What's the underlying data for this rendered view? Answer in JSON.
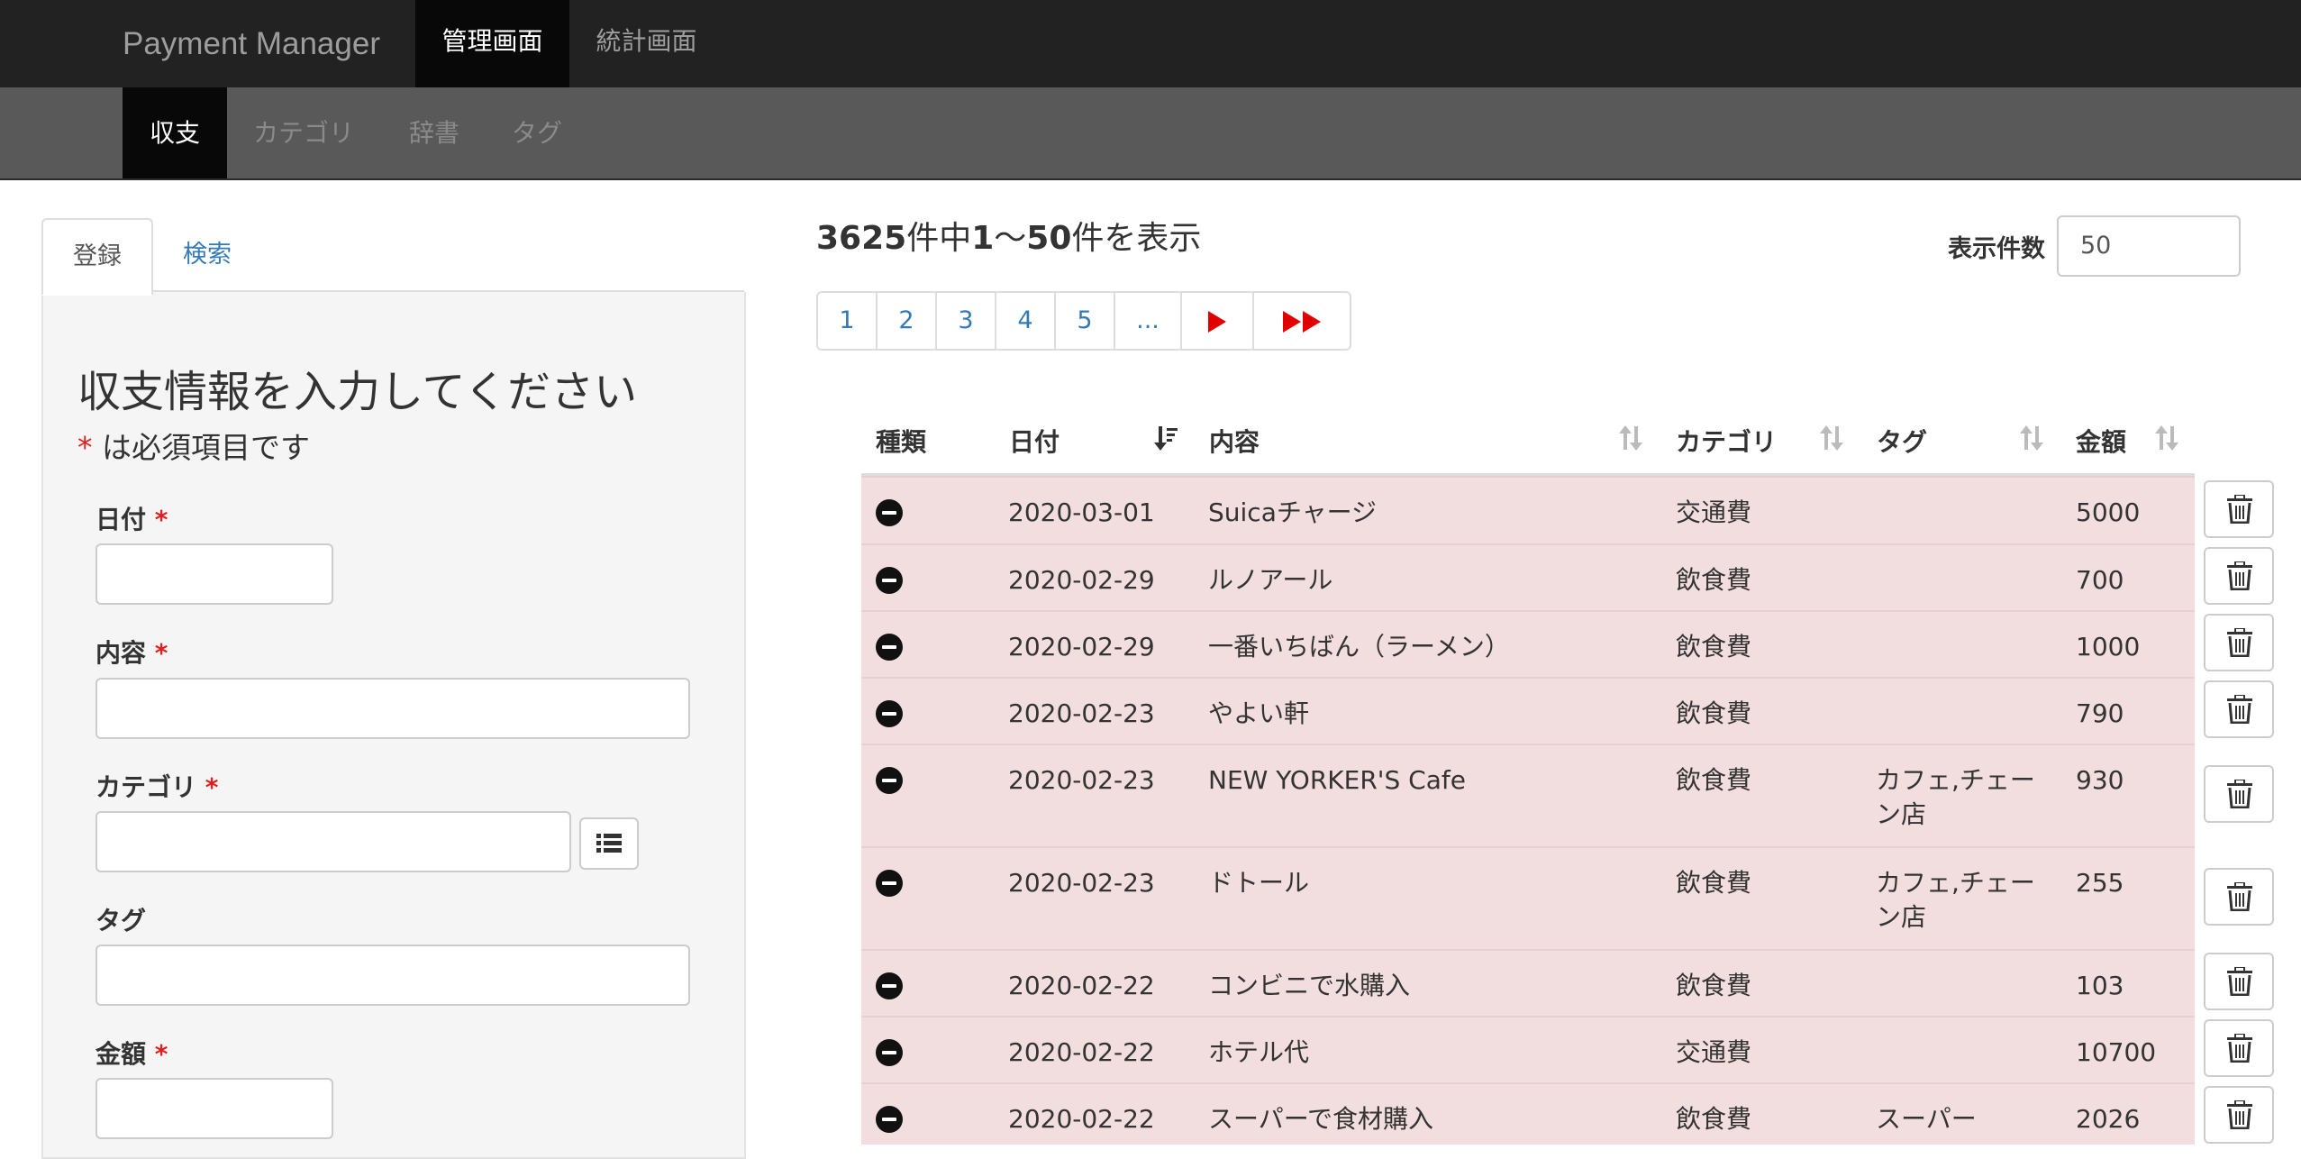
{
  "navbar": {
    "brand": "Payment Manager",
    "items": [
      {
        "label": "管理画面",
        "active": true
      },
      {
        "label": "統計画面",
        "active": false
      }
    ]
  },
  "subnav": {
    "items": [
      {
        "label": "収支",
        "active": true
      },
      {
        "label": "カテゴリ",
        "active": false
      },
      {
        "label": "辞書",
        "active": false
      },
      {
        "label": "タグ",
        "active": false
      }
    ]
  },
  "form": {
    "tabs": [
      {
        "label": "登録",
        "active": true
      },
      {
        "label": "検索",
        "active": false
      }
    ],
    "title": "収支情報を入力してください",
    "required_mark": "*",
    "required_note": " は必須項目です",
    "fields": {
      "date": {
        "label": "日付",
        "required": true,
        "value": ""
      },
      "content": {
        "label": "内容",
        "required": true,
        "value": ""
      },
      "category": {
        "label": "カテゴリ",
        "required": true,
        "value": ""
      },
      "tag": {
        "label": "タグ",
        "required": false,
        "value": ""
      },
      "amount": {
        "label": "金額",
        "required": true,
        "value": ""
      }
    },
    "category_list_icon": "list-icon"
  },
  "results": {
    "total": "3625",
    "text_mid": "件中",
    "range_start": "1",
    "tilde": "〜",
    "range_end": "50",
    "text_end": "件を表示",
    "per_page_label": "表示件数",
    "per_page_value": "50"
  },
  "pagination": {
    "pages": [
      "1",
      "2",
      "3",
      "4",
      "5",
      "..."
    ],
    "next_icon": "play-icon",
    "last_icon": "fast-forward-icon",
    "arrow_color": "#e00000"
  },
  "table": {
    "headers": {
      "type": "種類",
      "date": "日付",
      "content": "内容",
      "category": "カテゴリ",
      "tag": "タグ",
      "amount": "金額"
    },
    "row_color": "#f2dede",
    "rows": [
      {
        "type": "expense",
        "date": "2020-03-01",
        "content": "Suicaチャージ",
        "category": "交通費",
        "tag": "",
        "amount": "5000"
      },
      {
        "type": "expense",
        "date": "2020-02-29",
        "content": "ルノアール",
        "category": "飲食費",
        "tag": "",
        "amount": "700"
      },
      {
        "type": "expense",
        "date": "2020-02-29",
        "content": "一番いちばん（ラーメン）",
        "category": "飲食費",
        "tag": "",
        "amount": "1000"
      },
      {
        "type": "expense",
        "date": "2020-02-23",
        "content": "やよい軒",
        "category": "飲食費",
        "tag": "",
        "amount": "790"
      },
      {
        "type": "expense",
        "date": "2020-02-23",
        "content": "NEW YORKER'S Cafe",
        "category": "飲食費",
        "tag": "カフェ,チェーン店",
        "amount": "930"
      },
      {
        "type": "expense",
        "date": "2020-02-23",
        "content": "ドトール",
        "category": "飲食費",
        "tag": "カフェ,チェーン店",
        "amount": "255"
      },
      {
        "type": "expense",
        "date": "2020-02-22",
        "content": "コンビニで水購入",
        "category": "飲食費",
        "tag": "",
        "amount": "103"
      },
      {
        "type": "expense",
        "date": "2020-02-22",
        "content": "ホテル代",
        "category": "交通費",
        "tag": "",
        "amount": "10700"
      },
      {
        "type": "expense",
        "date": "2020-02-22",
        "content": "スーパーで食材購入",
        "category": "飲食費",
        "tag": "スーパー",
        "amount": "2026"
      }
    ]
  }
}
